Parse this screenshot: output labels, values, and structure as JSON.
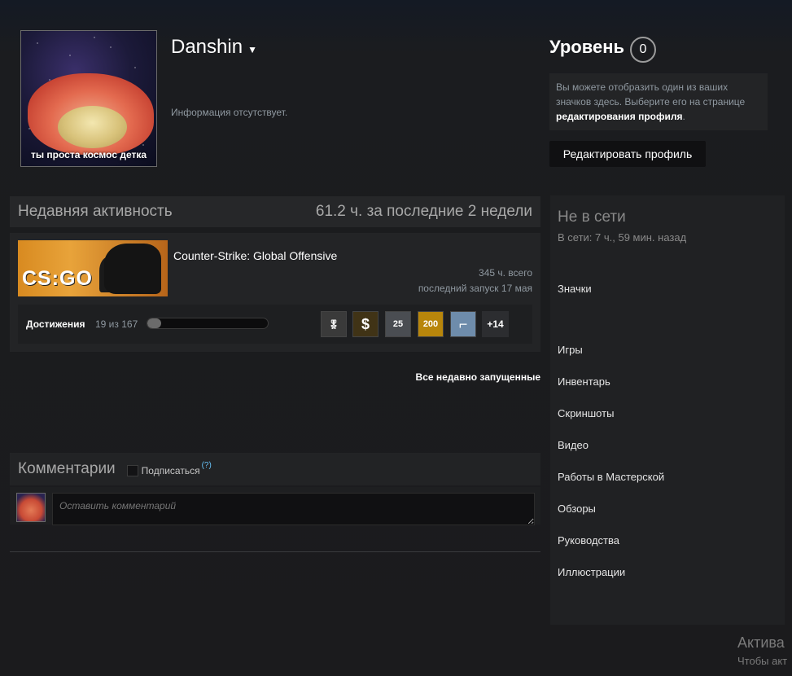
{
  "profile": {
    "avatar_caption": "ты проста космос детка",
    "username": "Danshin",
    "caret": "▼",
    "summary": "Информация отсутствует."
  },
  "level": {
    "title": "Уровень",
    "value": "0",
    "badge_hint_prefix": "Вы можете отобразить один из ваших значков здесь. Выберите его на странице ",
    "badge_hint_link": "редактирования профиля",
    "badge_hint_suffix": ".",
    "edit_button": "Редактировать профиль"
  },
  "status": {
    "title": "Не в сети",
    "last_online": "В сети: 7 ч., 59 мин. назад"
  },
  "sidebar_links": [
    "Значки",
    "Игры",
    "Инвентарь",
    "Скриншоты",
    "Видео",
    "Работы в Мастерской",
    "Обзоры",
    "Руководства",
    "Иллюстрации"
  ],
  "activity": {
    "header": "Недавняя активность",
    "hours_summary": "61.2 ч. за последние 2 недели",
    "game": {
      "logo_text": "CS:GO",
      "name": "Counter-Strike: Global Offensive",
      "total_hours": "345 ч. всего",
      "last_played": "последний запуск 17 мая"
    },
    "achievements": {
      "label": "Достижения",
      "count": "19 из 167",
      "progress": 0.114,
      "icons": [
        {
          "name": "medal-icon",
          "glyph": "🎖",
          "color": "#3a3a3a"
        },
        {
          "name": "dollar-icon",
          "glyph": "$",
          "color": "#403316"
        },
        {
          "name": "pistol-25-icon",
          "glyph": "25",
          "color": "#4a4d52"
        },
        {
          "name": "stars-200-icon",
          "glyph": "200",
          "color": "#b8860b"
        },
        {
          "name": "gun-icon",
          "glyph": "⌐",
          "color": "#6e8cab"
        }
      ],
      "more": "+14"
    },
    "all_recent": "Все недавно запущенные"
  },
  "comments": {
    "title": "Комментарии",
    "subscribe": "Подписаться",
    "help": "(?)",
    "placeholder": "Оставить комментарий"
  },
  "watermark": {
    "line1": "Актива",
    "line2": "Чтобы акт"
  }
}
